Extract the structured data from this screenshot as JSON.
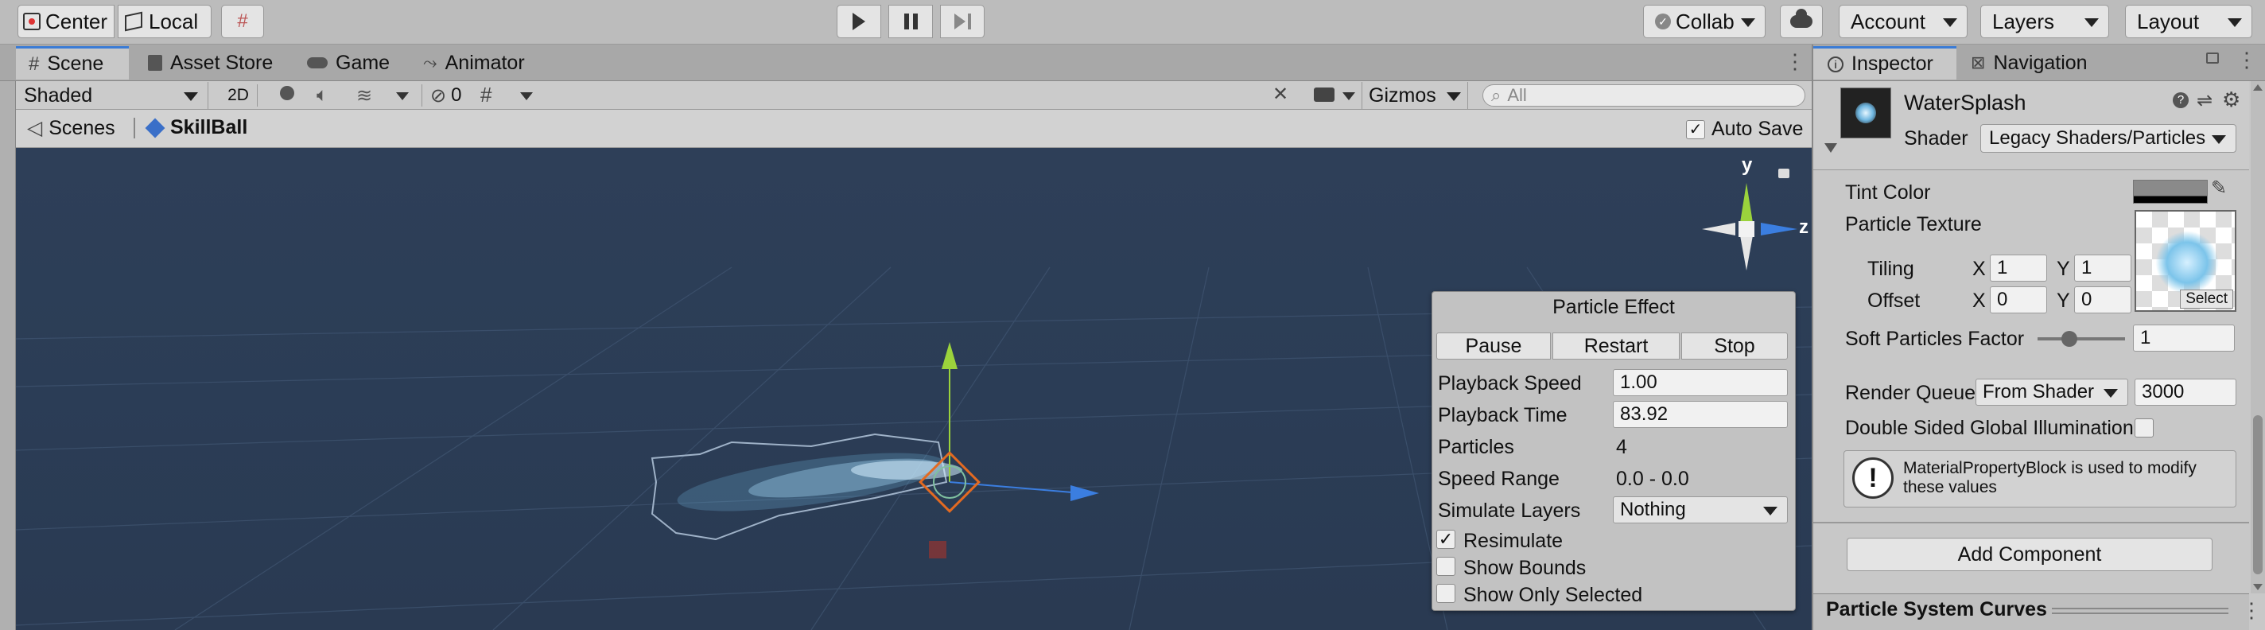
{
  "toolbar": {
    "center_label": "Center",
    "local_label": "Local",
    "collab_label": "Collab",
    "account_label": "Account",
    "layers_label": "Layers",
    "layout_label": "Layout"
  },
  "tabs": {
    "scene": "Scene",
    "asset_store": "Asset Store",
    "game": "Game",
    "animator": "Animator",
    "inspector": "Inspector",
    "navigation": "Navigation"
  },
  "scene_toolbar": {
    "shading_mode": "Shaded",
    "mode_2d": "2D",
    "hidden_count": "0",
    "gizmos_label": "Gizmos",
    "search_placeholder": "All"
  },
  "breadcrumb": {
    "scenes": "Scenes",
    "current": "SkillBall",
    "auto_save": "Auto Save"
  },
  "scene_gizmo": {
    "y_label": "y",
    "z_label": "z"
  },
  "particle_effect": {
    "title": "Particle Effect",
    "pause": "Pause",
    "restart": "Restart",
    "stop": "Stop",
    "playback_speed_label": "Playback Speed",
    "playback_speed": "1.00",
    "playback_time_label": "Playback Time",
    "playback_time": "83.92",
    "particles_label": "Particles",
    "particles": "4",
    "speed_range_label": "Speed Range",
    "speed_range": "0.0 - 0.0",
    "simulate_layers_label": "Simulate Layers",
    "simulate_layers": "Nothing",
    "resimulate": "Resimulate",
    "show_bounds": "Show Bounds",
    "show_only_selected": "Show Only Selected"
  },
  "inspector": {
    "material_name": "WaterSplash",
    "shader_label": "Shader",
    "shader_value": "Legacy Shaders/Particles",
    "tint_color_label": "Tint Color",
    "particle_texture_label": "Particle Texture",
    "tiling_label": "Tiling",
    "offset_label": "Offset",
    "x_label": "X",
    "y_label": "Y",
    "tiling_x": "1",
    "tiling_y": "1",
    "offset_x": "0",
    "offset_y": "0",
    "select_label": "Select",
    "soft_particles_label": "Soft Particles Factor",
    "soft_particles_value": "1",
    "render_queue_label": "Render Queue",
    "render_queue_mode": "From Shader",
    "render_queue_value": "3000",
    "double_sided_label": "Double Sided Global Illumination",
    "info_text": "MaterialPropertyBlock is used to modify these values",
    "add_component": "Add Component",
    "curves_title": "Particle System Curves"
  }
}
